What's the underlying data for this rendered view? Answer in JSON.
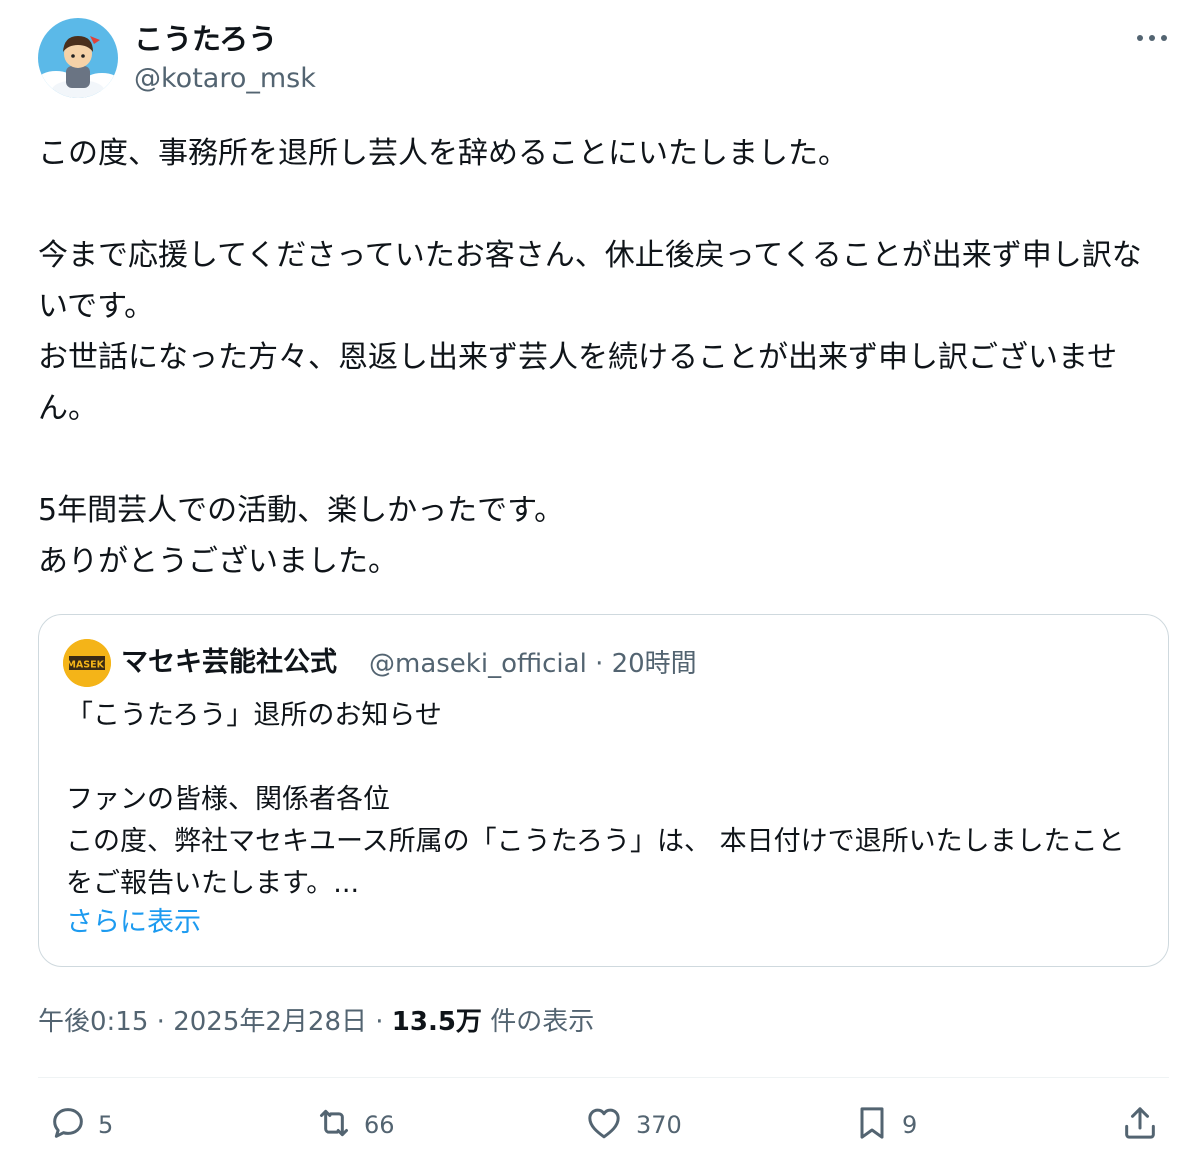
{
  "author": {
    "display_name": "こうたろう",
    "handle": "@kotaro_msk"
  },
  "post": {
    "text": "この度、事務所を退所し芸人を辞めることにいたしました。\n\n今まで応援してくださっていたお客さん、休止後戻ってくることが出来ず申し訳ないです。\nお世話になった方々、恩返し出来ず芸人を続けることが出来ず申し訳ございません。\n\n5年間芸人での活動、楽しかったです。\nありがとうございました。"
  },
  "quote": {
    "avatar_text": "MASEKI",
    "display_name": "マセキ芸能社公式",
    "handle_time": "@maseki_official · 20時間",
    "text": "「こうたろう」退所のお知らせ\n\nファンの皆様、関係者各位\nこの度、弊社マセキユース所属の「こうたろう」は、 本日付けで退所いたしましたことをご報告いたします。...",
    "show_more": "さらに表示"
  },
  "meta": {
    "time": "午後0:15",
    "date": "2025年2月28日",
    "views_count": "13.5万",
    "views_label": "件の表示"
  },
  "actions": {
    "reply": "5",
    "repost": "66",
    "like": "370",
    "bookmark": "9"
  },
  "icons": {
    "more": "more-icon",
    "reply": "reply-icon",
    "repost": "repost-icon",
    "like": "heart-icon",
    "bookmark": "bookmark-icon",
    "share": "share-icon"
  },
  "colors": {
    "link": "#1d9bf0",
    "secondary": "#536471",
    "text": "#0f1419",
    "maseki_brand": "#f4b418"
  }
}
